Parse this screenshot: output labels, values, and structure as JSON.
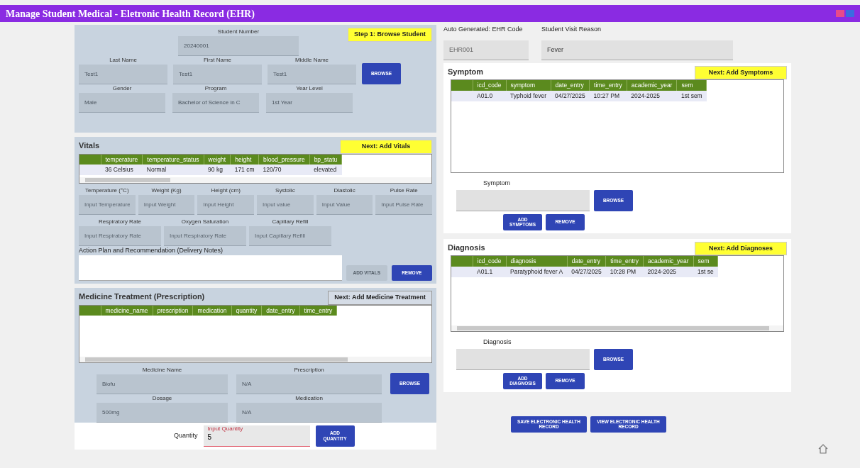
{
  "window": {
    "title": "Manage Student Medical - Eletronic Health Record (EHR)"
  },
  "student": {
    "step_label": "Step 1: Browse Student",
    "browse": "BROWSE",
    "number": {
      "label": "Student Number",
      "value": "20240001"
    },
    "names": [
      {
        "label": "Last Name",
        "value": "Test1"
      },
      {
        "label": "First Name",
        "value": "Test1"
      },
      {
        "label": "Middle Name",
        "value": "Test1"
      }
    ],
    "details": [
      {
        "label": "Gender",
        "value": "Male"
      },
      {
        "label": "Program",
        "value": "Bachelor of Science in C"
      },
      {
        "label": "Year Level",
        "value": "1st Year"
      }
    ]
  },
  "vitals": {
    "title": "Vitals",
    "next_label": "Next: Add Vitals",
    "table": {
      "columns": [
        "temperature",
        "temperature_status",
        "weight",
        "height",
        "blood_pressure",
        "bp_statu"
      ],
      "rows": [
        [
          "36 Celsius",
          "Normal",
          "90 kg",
          "171 cm",
          "120/70",
          "elevated"
        ]
      ]
    },
    "fields": [
      {
        "label": "Temperature (°C)",
        "placeholder": "Input Temperature"
      },
      {
        "label": "Weight (Kg)",
        "placeholder": "Input Weight"
      },
      {
        "label": "Height (cm)",
        "placeholder": "Input Height"
      },
      {
        "label": "Systolic",
        "placeholder": "Input value"
      },
      {
        "label": "Diastolic",
        "placeholder": "Input Value"
      },
      {
        "label": "Pulse Rate",
        "placeholder": "Input Pulse Rate"
      }
    ],
    "fields_2": [
      {
        "label": "Respiratory Rate",
        "placeholder": "Input Respiratory Rate"
      },
      {
        "label": "Oxygen Saturation",
        "placeholder": "Input Respiratory Rate"
      },
      {
        "label": "Capillary Refill",
        "placeholder": "Input Capillary Refill"
      }
    ],
    "notes_label": "Action Plan and Recommendation (Delivery Notes)",
    "buttons": [
      {
        "label": "ADD VITALS",
        "disabled": true
      },
      {
        "label": "REMOVE",
        "disabled": false
      }
    ]
  },
  "medicine": {
    "title": "Medicine Treatment (Prescription)",
    "next_label": "Next: Add Medicine Treatment",
    "table": {
      "columns": [
        "medicine_name",
        "prescription",
        "medication",
        "quantity",
        "date_entry",
        "time_entry"
      ]
    },
    "fields": [
      {
        "label": "Medicine Name",
        "value": "Biofu"
      },
      {
        "label": "Prescription",
        "value": "N/A"
      },
      {
        "label": "Dosage",
        "value": "500mg"
      },
      {
        "label": "Medication",
        "value": "N/A"
      }
    ],
    "browse": "BROWSE",
    "quantity": {
      "label": "Quantity",
      "placeholder": "Input Quantity",
      "value": "5"
    },
    "add_button": "ADD QUANTITY"
  },
  "ehr": {
    "code": {
      "label": "Auto Generated: EHR Code",
      "value": "EHR001"
    },
    "reason": {
      "label": "Student Visit Reason",
      "value": "Fever"
    }
  },
  "symptom": {
    "title": "Symptom",
    "next_label": "Next: Add Symptoms",
    "table": {
      "columns": [
        "icd_code",
        "symptom",
        "date_entry",
        "time_entry",
        "academic_year",
        "sem"
      ],
      "rows": [
        [
          "A01.0",
          "Typhoid fever",
          "04/27/2025",
          "10:27 PM",
          "2024-2025",
          "1st sem"
        ]
      ]
    },
    "field_label": "Symptom",
    "browse": "BROWSE",
    "buttons": [
      "ADD SYMPTOMS",
      "REMOVE"
    ]
  },
  "diagnosis": {
    "title": "Diagnosis",
    "next_label": "Next: Add Diagnoses",
    "table": {
      "columns": [
        "icd_code",
        "diagnosis",
        "date_entry",
        "time_entry",
        "academic_year",
        "sem"
      ],
      "rows": [
        [
          "A01.1",
          "Paratyphoid fever A",
          "04/27/2025",
          "10:28 PM",
          "2024-2025",
          "1st se"
        ]
      ]
    },
    "field_label": "Diagnosis",
    "browse": "BROWSE",
    "buttons": [
      "ADD DIAGNOSIS",
      "REMOVE"
    ]
  },
  "footer_buttons": [
    "SAVE ELECTRONIC HEALTH RECORD",
    "VIEW ELECTRONIC HEALTH RECORD"
  ]
}
